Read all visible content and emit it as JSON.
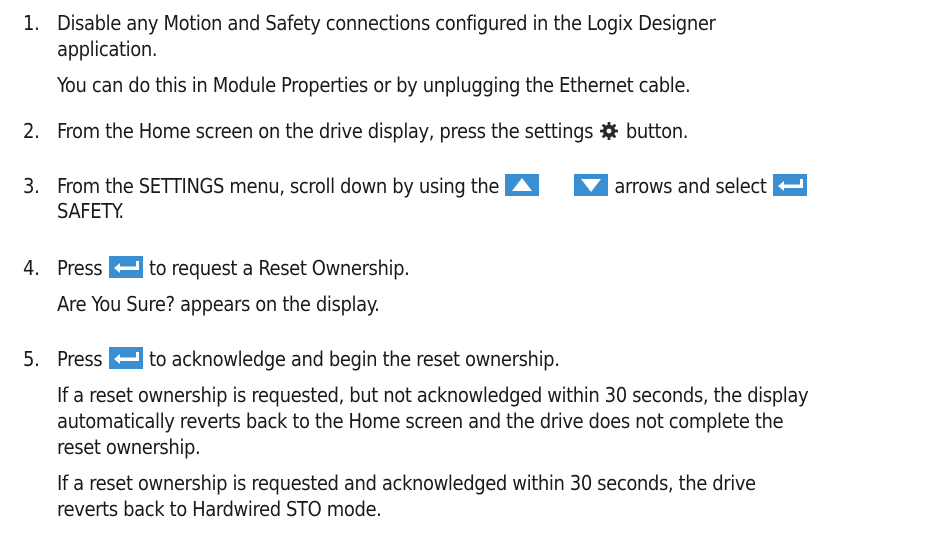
{
  "steps": [
    {
      "number": "1.",
      "line1": "Disable any Motion and Safety connections configured in the Logix Designer",
      "line2": "application.",
      "note": "You can do this in Module Properties or by unplugging the Ethernet cable."
    },
    {
      "number": "2.",
      "text_before": "From the Home screen on the drive display, press the settings",
      "text_after": "button."
    },
    {
      "number": "3.",
      "text_before": "From the SETTINGS menu, scroll down by using the",
      "text_middle": "arrows and select",
      "line2": "SAFETY."
    },
    {
      "number": "4.",
      "text_before": "Press",
      "text_after": "to request a Reset Ownership.",
      "note": "Are You Sure? appears on the display."
    },
    {
      "number": "5.",
      "text_before": "Press",
      "text_after": "to acknowledge and begin the reset ownership.",
      "note1_line1": "If a reset ownership is requested, but not acknowledged within 30 seconds, the display",
      "note1_line2": "automatically reverts back to the Home screen and the drive does not complete the",
      "note1_line3": "reset ownership.",
      "note2_line1": "If a reset ownership is requested and acknowledged within 30 seconds, the drive",
      "note2_line2": "reverts back to Hardwired STO mode."
    }
  ],
  "icons": {
    "settings": "gear-icon",
    "up": "up-arrow-button-icon",
    "down": "down-arrow-button-icon",
    "enter": "enter-button-icon",
    "button_color": "#3a8fd3"
  }
}
